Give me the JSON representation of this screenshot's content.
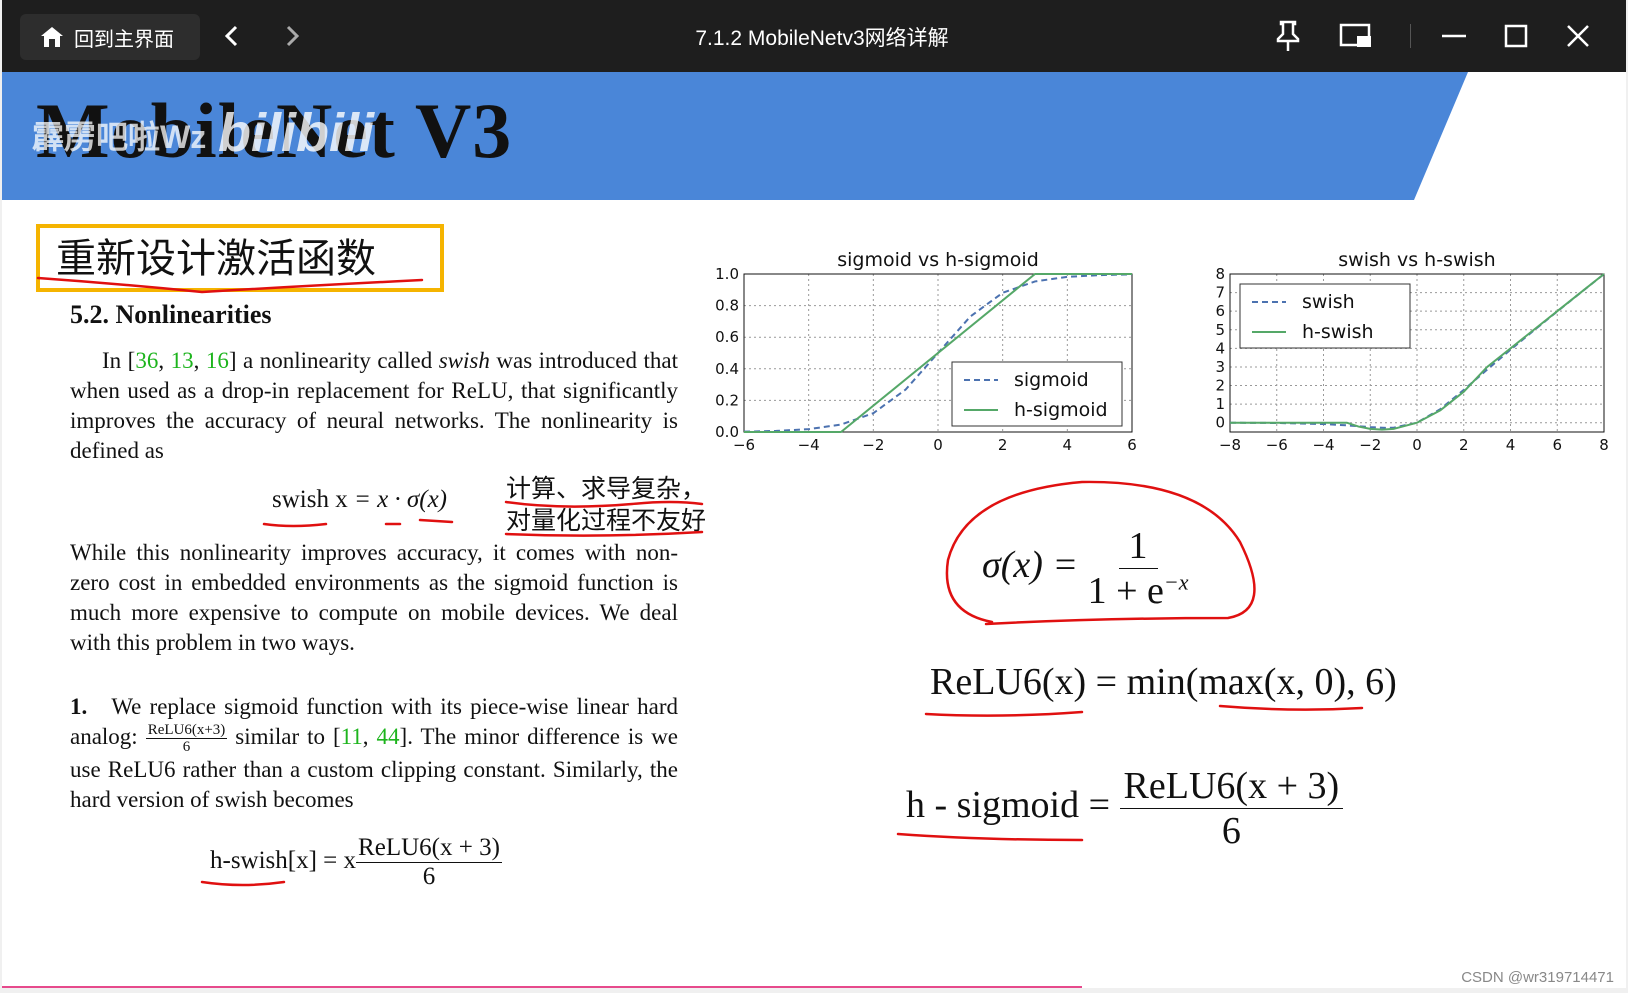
{
  "titlebar": {
    "home_label": "回到主界面",
    "title": "7.1.2 MobileNetv3网络详解",
    "icons": [
      "home-icon",
      "back-icon",
      "forward-icon",
      "pin-icon",
      "pip-icon",
      "minimize-icon",
      "maximize-icon",
      "close-icon"
    ]
  },
  "slide": {
    "title": "MobileNet V3",
    "watermark": "霹雳吧啦Wz",
    "bili_logo": "bilibili",
    "section_title": "重新设计激活函数",
    "colors": {
      "banner": "#4a86d8",
      "box": "#f5b400",
      "ink": "#e01010",
      "green": "#1db41d"
    }
  },
  "paper": {
    "heading": "5.2. Nonlinearities",
    "para1_a": "In [",
    "ref1": "36",
    "ref2": "13",
    "ref3": "16",
    "para1_b": "] a nonlinearity called ",
    "para1_swish": "swish",
    "para1_c": " was introduced that when used as a drop-in replacement for ReLU, that significantly improves the accuracy of neural networks. The nonlinearity is defined as",
    "eq1_lhs": "swish x",
    "eq1_rhs": " = x · σ(x)",
    "para2": "While this nonlinearity improves accuracy, it comes with non-zero cost in embedded environments as the sigmoid function is much more expensive to compute on mobile devices. We deal with this problem in two ways.",
    "item_num": "1.",
    "item_a": "We replace sigmoid function with its piece-wise linear hard analog:",
    "item_frac_num": "ReLU6(x+3)",
    "item_frac_den": "6",
    "item_b": " similar to [",
    "ref4": "11",
    "ref5": "44",
    "item_c": "]. The minor difference is we use ReLU6 rather than a custom clipping constant. Similarly, the hard version of swish becomes",
    "eq2_lhs": "h-swish[x] = x",
    "eq2_num": "ReLU6(x + 3)",
    "eq2_den": "6"
  },
  "annotation": {
    "line1": "计算、求导复杂，",
    "line2": "对量化过程不友好"
  },
  "formulas": {
    "sigma_lhs": "σ(x) =",
    "sigma_num": "1",
    "sigma_den": "1 + e",
    "sigma_exp": "−x",
    "relu6": "ReLU6(x) = min(max(x, 0), 6)",
    "hsig_lhs": "h - sigmoid =",
    "hsig_num": "ReLU6(x + 3)",
    "hsig_den": "6"
  },
  "chart_data": [
    {
      "type": "line",
      "title": "sigmoid vs h-sigmoid",
      "xlim": [
        -6,
        6
      ],
      "ylim": [
        0,
        1
      ],
      "xticks": [
        "−6",
        "−4",
        "−2",
        "0",
        "2",
        "4",
        "6"
      ],
      "yticks": [
        "0.0",
        "0.2",
        "0.4",
        "0.6",
        "0.8",
        "1.0"
      ],
      "grid": true,
      "legend": "lower-right",
      "series": [
        {
          "name": "sigmoid",
          "style": "dashed",
          "color": "#4c72b0",
          "x": [
            -6,
            -5,
            -4,
            -3,
            -2,
            -1,
            0,
            1,
            2,
            3,
            4,
            5,
            6
          ],
          "y": [
            0.002,
            0.007,
            0.018,
            0.047,
            0.119,
            0.269,
            0.5,
            0.731,
            0.881,
            0.953,
            0.982,
            0.993,
            0.998
          ]
        },
        {
          "name": "h-sigmoid",
          "style": "solid",
          "color": "#55a868",
          "x": [
            -6,
            -3,
            3,
            6
          ],
          "y": [
            0,
            0,
            1,
            1
          ]
        }
      ]
    },
    {
      "type": "line",
      "title": "swish vs h-swish",
      "xlim": [
        -8,
        8
      ],
      "ylim": [
        -0.5,
        8
      ],
      "xticks": [
        "−8",
        "−6",
        "−4",
        "−2",
        "0",
        "2",
        "4",
        "6",
        "8"
      ],
      "yticks": [
        "0",
        "1",
        "2",
        "3",
        "4",
        "5",
        "6",
        "7",
        "8"
      ],
      "grid": true,
      "legend": "upper-left",
      "series": [
        {
          "name": "swish",
          "style": "dashed",
          "color": "#4c72b0",
          "x": [
            -8,
            -6,
            -4,
            -3,
            -2,
            -1.3,
            -1,
            0,
            1,
            2,
            3,
            4,
            5,
            6,
            7,
            8
          ],
          "y": [
            -0.003,
            -0.015,
            -0.072,
            -0.142,
            -0.238,
            -0.278,
            -0.269,
            0,
            0.731,
            1.762,
            2.858,
            3.928,
            4.966,
            5.985,
            6.994,
            7.997
          ]
        },
        {
          "name": "h-swish",
          "style": "solid",
          "color": "#55a868",
          "x": [
            -8,
            -3,
            -2.5,
            -2,
            -1.5,
            -1,
            0,
            1,
            2,
            3,
            4,
            5,
            6,
            7,
            8
          ],
          "y": [
            0,
            0,
            -0.208,
            -0.333,
            -0.375,
            -0.333,
            0,
            0.667,
            1.667,
            3,
            4,
            5,
            6,
            7,
            8
          ]
        }
      ]
    }
  ]
}
